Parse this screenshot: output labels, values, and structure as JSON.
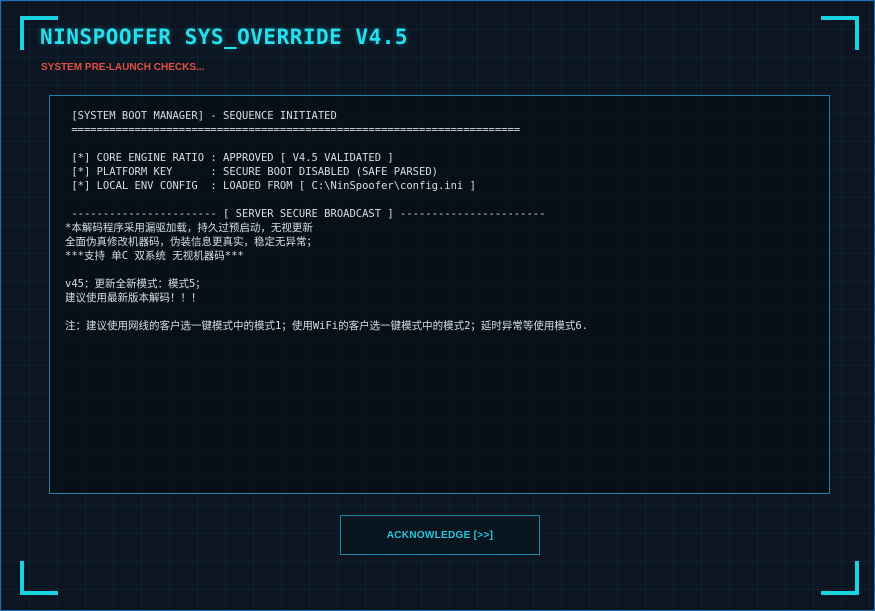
{
  "header": {
    "title": "NINSPOOFER SYS_OVERRIDE V4.5",
    "subtitle": "SYSTEM PRE-LAUNCH CHECKS..."
  },
  "console": {
    "boot_header": " [SYSTEM BOOT MANAGER] - SEQUENCE INITIATED",
    "separator": " =======================================================================",
    "checks": [
      " [*] CORE ENGINE RATIO : APPROVED [ V4.5 VALIDATED ]",
      " [*] PLATFORM KEY      : SECURE BOOT DISABLED (SAFE PARSED)",
      " [*] LOCAL ENV CONFIG  : LOADED FROM [ C:\\NinSpoofer\\config.ini ]"
    ],
    "broadcast_header": " ----------------------- [ SERVER SECURE BROADCAST ] -----------------------",
    "broadcast_lines": [
      "*本解码程序采用漏驱加载，持久过预启动，无视更新",
      "全面伪真修改机器码，伪装信息更真实，稳定无异常；",
      "***支持 单C 双系统 无视机器码***"
    ],
    "update_lines": [
      "v45：更新全新模式：模式5；",
      "建议使用最新版本解码！！！"
    ],
    "note": "注：建议使用网线的客户选一键模式中的模式1；使用WiFi的客户选一键模式中的模式2；延时异常等使用模式6."
  },
  "actions": {
    "acknowledge_label": "ACKNOWLEDGE [>>]"
  },
  "colors": {
    "accent": "#25e0ee",
    "warning": "#e2503f",
    "border": "#1f7fa8",
    "background": "#0b1622"
  }
}
